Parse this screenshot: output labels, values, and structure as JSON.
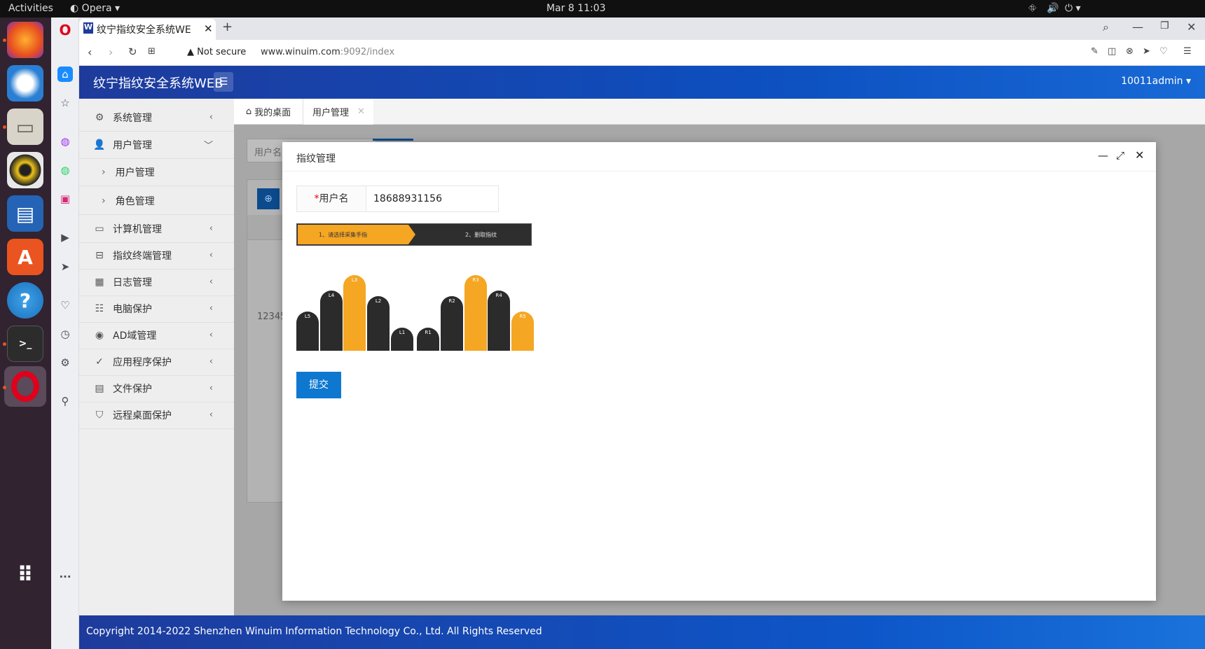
{
  "system_bar": {
    "activities": "Activities",
    "app": "Opera",
    "clock": "Mar 8  11:03"
  },
  "browser": {
    "tab_title": "纹宁指纹安全系统WE",
    "security_label": "Not secure",
    "url_host": "www.winuim.com",
    "url_path": ":9092/index"
  },
  "app": {
    "title": "纹宁指纹安全系统WEB",
    "user": "10011admin",
    "footer": "Copyright 2014-2022 Shenzhen Winuim Information Technology Co., Ltd. All Rights Reserved"
  },
  "sidebar": {
    "items": [
      {
        "label": "系统管理",
        "icon": "gear-icon",
        "glyph": "⚙"
      },
      {
        "label": "用户管理",
        "icon": "user-icon",
        "glyph": "👤"
      },
      {
        "label": "用户管理",
        "sub": true
      },
      {
        "label": "角色管理",
        "sub": true
      },
      {
        "label": "计算机管理",
        "icon": "monitor-icon",
        "glyph": "▭"
      },
      {
        "label": "指纹终端管理",
        "icon": "terminal-icon",
        "glyph": "⊟"
      },
      {
        "label": "日志管理",
        "icon": "calendar-icon",
        "glyph": "▦"
      },
      {
        "label": "电脑保护",
        "icon": "list-icon",
        "glyph": "☷"
      },
      {
        "label": "AD域管理",
        "icon": "account-icon",
        "glyph": "◉"
      },
      {
        "label": "应用程序保护",
        "icon": "check-circle-icon",
        "glyph": "✓"
      },
      {
        "label": "文件保护",
        "icon": "file-icon",
        "glyph": "▤"
      },
      {
        "label": "远程桌面保护",
        "icon": "shield-icon",
        "glyph": "⛉"
      }
    ]
  },
  "content_tabs": {
    "home": "我的桌面",
    "active": "用户管理"
  },
  "background_page": {
    "search_placeholder": "用户名",
    "row_value": "12345"
  },
  "modal": {
    "title": "指纹管理",
    "username_label": "用户名",
    "required_mark": "*",
    "username_value": "18688931156",
    "step1": "1、请选择采集手指",
    "step2": "2、删取指纹",
    "submit": "提交",
    "fingers": [
      "L5",
      "L4",
      "L3",
      "L2",
      "L1",
      "R1",
      "R2",
      "R3",
      "R4",
      "R5"
    ]
  },
  "colors": {
    "accent": "#1e3b9c",
    "orange": "#f5a623",
    "button": "#0e78d0"
  }
}
